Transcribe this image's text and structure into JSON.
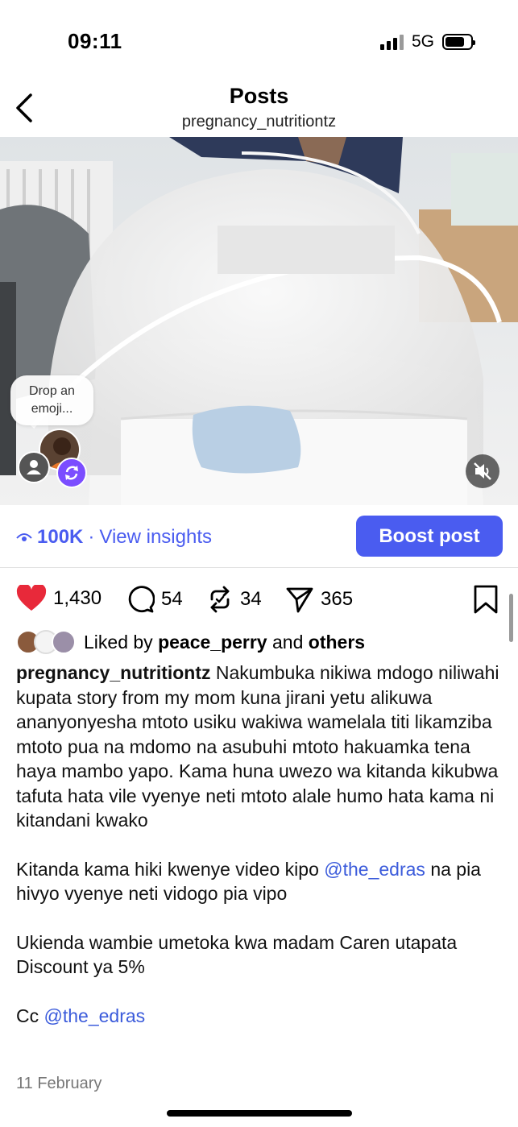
{
  "status": {
    "time": "09:11",
    "network": "5G"
  },
  "header": {
    "title": "Posts",
    "subtitle": "pregnancy_nutritiontz"
  },
  "media": {
    "emoji_prompt_line1": "Drop an",
    "emoji_prompt_line2": "emoji..."
  },
  "insights": {
    "views": "100K",
    "separator": "·",
    "view_insights": "View insights",
    "boost_label": "Boost post"
  },
  "actions": {
    "likes": "1,430",
    "comments": "54",
    "reposts": "34",
    "shares": "365"
  },
  "liked_by": {
    "prefix": "Liked by",
    "user": "peace_perry",
    "and": "and",
    "others": "others"
  },
  "caption": {
    "username": "pregnancy_nutritiontz",
    "para1": "Nakumbuka nikiwa mdogo niliwahi kupata story from my mom kuna jirani yetu alikuwa ananyonyesha mtoto usiku wakiwa wamelala titi likamziba mtoto pua na mdomo na asubuhi mtoto hakuamka tena haya mambo yapo. Kama huna uwezo wa kitanda kikubwa tafuta hata vile vyenye neti mtoto alale humo hata kama ni kitandani kwako",
    "para2_before": "Kitanda kama hiki kwenye video kipo",
    "para2_mention": "@the_edras",
    "para2_after": "na pia hivyo vyenye neti vidogo pia vipo",
    "para3": "Ukienda wambie umetoka kwa madam Caren utapata Discount ya 5%",
    "para4_prefix": "Cc",
    "para4_mention": "@the_edras"
  },
  "date": "11 February",
  "colors": {
    "accent": "#4a5cf0",
    "like": "#e8293a",
    "mention": "#3b5bdb"
  }
}
